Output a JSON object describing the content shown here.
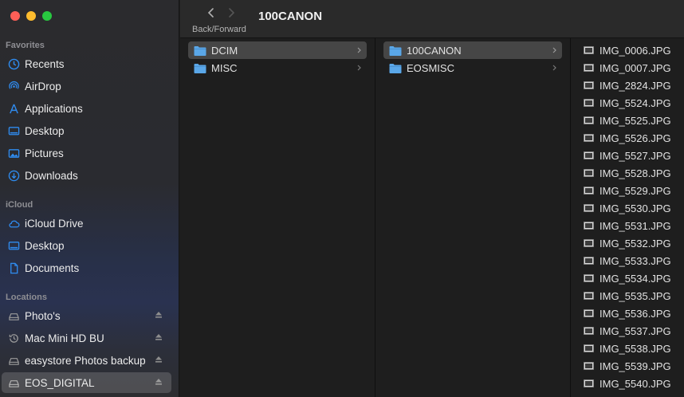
{
  "window": {
    "title": "100CANON"
  },
  "toolbar": {
    "nav_caption": "Back/Forward"
  },
  "sidebar": {
    "favorites": {
      "title": "Favorites",
      "items": [
        {
          "label": "Recents",
          "icon": "clock-icon"
        },
        {
          "label": "AirDrop",
          "icon": "airdrop-icon"
        },
        {
          "label": "Applications",
          "icon": "applications-icon"
        },
        {
          "label": "Desktop",
          "icon": "desktop-icon"
        },
        {
          "label": "Pictures",
          "icon": "pictures-icon"
        },
        {
          "label": "Downloads",
          "icon": "downloads-icon"
        }
      ]
    },
    "icloud": {
      "title": "iCloud",
      "items": [
        {
          "label": "iCloud Drive",
          "icon": "cloud-icon"
        },
        {
          "label": "Desktop",
          "icon": "desktop-icon"
        },
        {
          "label": "Documents",
          "icon": "document-icon"
        }
      ]
    },
    "locations": {
      "title": "Locations",
      "items": [
        {
          "label": "Photo's",
          "icon": "drive-icon",
          "eject": true
        },
        {
          "label": "Mac Mini HD BU",
          "icon": "time-machine-icon",
          "eject": true
        },
        {
          "label": "easystore Photos backup",
          "icon": "drive-icon",
          "eject": true
        },
        {
          "label": "EOS_DIGITAL",
          "icon": "drive-icon",
          "eject": true,
          "selected": true
        }
      ]
    }
  },
  "columns": {
    "col1": [
      {
        "label": "DCIM",
        "selected": true
      },
      {
        "label": "MISC",
        "selected": false
      }
    ],
    "col2": [
      {
        "label": "100CANON",
        "selected": true
      },
      {
        "label": "EOSMISC",
        "selected": false
      }
    ],
    "files": [
      "IMG_0006.JPG",
      "IMG_0007.JPG",
      "IMG_2824.JPG",
      "IMG_5524.JPG",
      "IMG_5525.JPG",
      "IMG_5526.JPG",
      "IMG_5527.JPG",
      "IMG_5528.JPG",
      "IMG_5529.JPG",
      "IMG_5530.JPG",
      "IMG_5531.JPG",
      "IMG_5532.JPG",
      "IMG_5533.JPG",
      "IMG_5534.JPG",
      "IMG_5535.JPG",
      "IMG_5536.JPG",
      "IMG_5537.JPG",
      "IMG_5538.JPG",
      "IMG_5539.JPG",
      "IMG_5540.JPG"
    ]
  },
  "colors": {
    "accent": "#2f8cf0",
    "folder": "#5aa7e8"
  }
}
